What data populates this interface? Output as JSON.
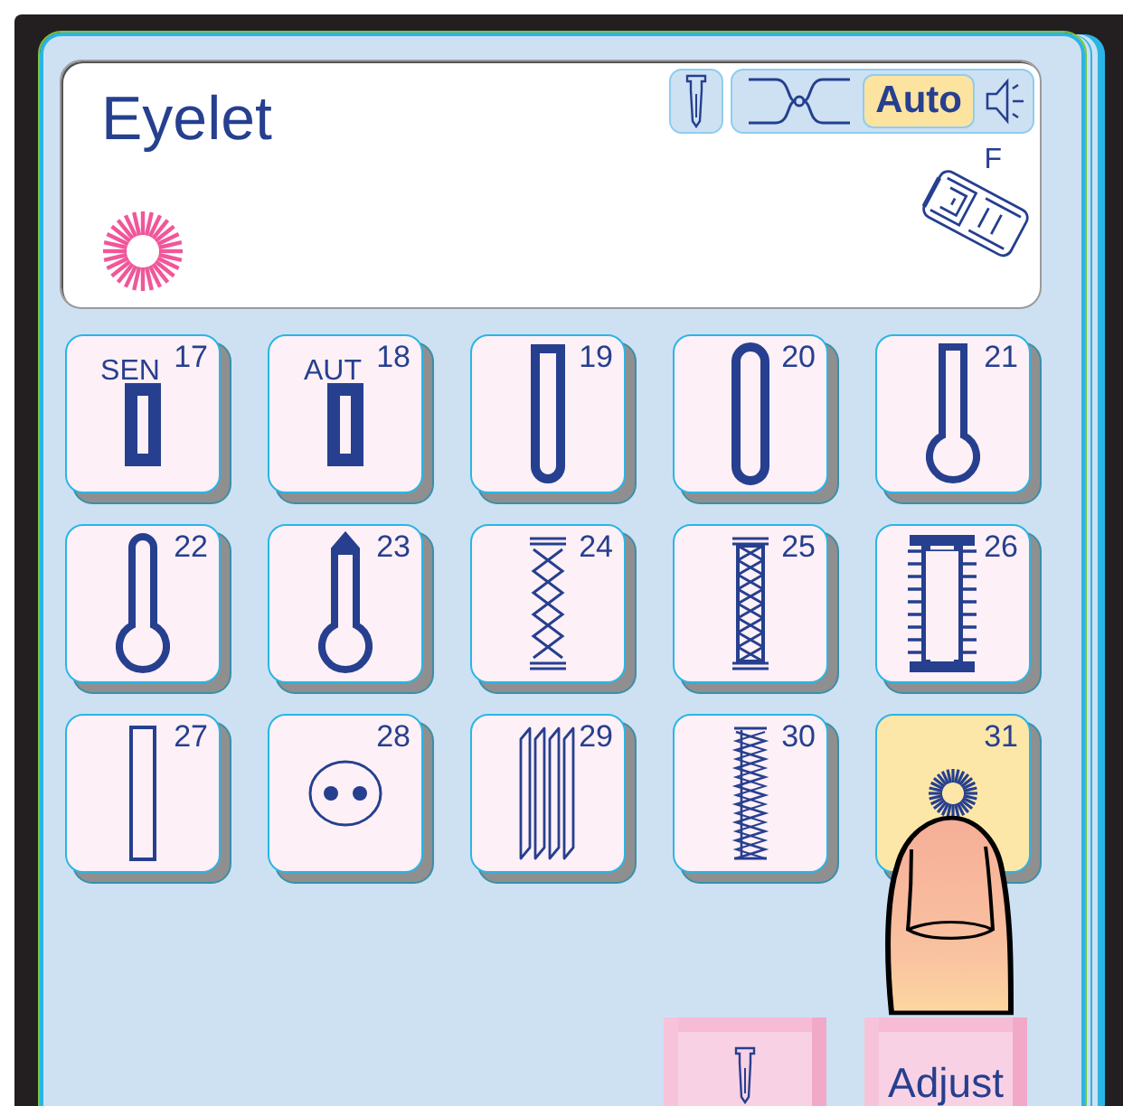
{
  "display": {
    "title": "Eyelet",
    "auto_label": "Auto",
    "foot_label": "F"
  },
  "stitches": [
    {
      "number": "17",
      "label": "SEN",
      "kind": "square-buttonhole",
      "selected": false
    },
    {
      "number": "18",
      "label": "AUT",
      "kind": "square-buttonhole",
      "selected": false
    },
    {
      "number": "19",
      "kind": "round-end-buttonhole",
      "selected": false
    },
    {
      "number": "20",
      "kind": "oval-buttonhole",
      "selected": false
    },
    {
      "number": "21",
      "kind": "keyhole-square",
      "selected": false
    },
    {
      "number": "22",
      "kind": "keyhole-round",
      "selected": false
    },
    {
      "number": "23",
      "kind": "keyhole-pointed",
      "selected": false
    },
    {
      "number": "24",
      "kind": "zigzag-chain",
      "selected": false
    },
    {
      "number": "25",
      "kind": "crosshatch",
      "selected": false
    },
    {
      "number": "26",
      "kind": "ladder",
      "selected": false
    },
    {
      "number": "27",
      "kind": "outline-rect",
      "selected": false
    },
    {
      "number": "28",
      "kind": "button-sew",
      "selected": false
    },
    {
      "number": "29",
      "kind": "slanted-lines",
      "selected": false
    },
    {
      "number": "30",
      "kind": "dense-zigzag",
      "selected": false
    },
    {
      "number": "31",
      "kind": "eyelet",
      "selected": true
    }
  ],
  "buttons": [
    {
      "kind": "needle"
    },
    {
      "kind": "text",
      "label": "Adjust"
    }
  ]
}
